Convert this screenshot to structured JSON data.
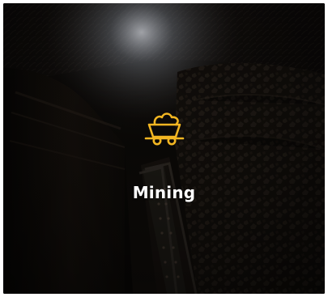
{
  "card": {
    "title": "Mining",
    "icon": "mine-cart-icon",
    "accent_color": "#f2b622",
    "background_image": "underground-mine-tunnel-with-rail-track"
  }
}
